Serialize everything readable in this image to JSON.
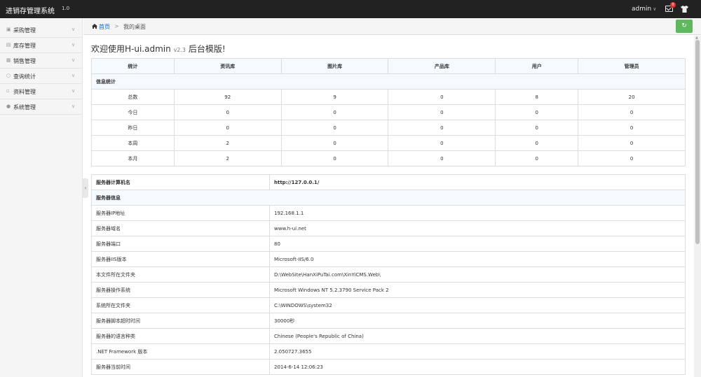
{
  "topbar": {
    "logo": "进销存管理系统",
    "version": "1.0",
    "user": "admin",
    "caret": "∨",
    "message_count": "0"
  },
  "sidebar": {
    "items": [
      {
        "label": "采购管理",
        "icon": "cart-icon"
      },
      {
        "label": "库存管理",
        "icon": "box-icon"
      },
      {
        "label": "销售管理",
        "icon": "tag-icon"
      },
      {
        "label": "查询统计",
        "icon": "search-icon"
      },
      {
        "label": "资料管理",
        "icon": "doc-icon"
      },
      {
        "label": "系统管理",
        "icon": "user-icon"
      }
    ]
  },
  "breadcrumb": {
    "home": "首页",
    "sep": ">",
    "current": "我的桌面"
  },
  "welcome": {
    "prefix": "欢迎使用",
    "product": "H-ui.admin",
    "version": "v2.3",
    "suffix": "后台模版!"
  },
  "stats": {
    "caption": "信息统计",
    "headers": [
      "统计",
      "资讯库",
      "图片库",
      "产品库",
      "用户",
      "管理员"
    ],
    "rows": [
      [
        "总数",
        "92",
        "9",
        "0",
        "8",
        "20"
      ],
      [
        "今日",
        "0",
        "0",
        "0",
        "0",
        "0"
      ],
      [
        "昨日",
        "0",
        "0",
        "0",
        "0",
        "0"
      ],
      [
        "本周",
        "2",
        "0",
        "0",
        "0",
        "0"
      ],
      [
        "本月",
        "2",
        "0",
        "0",
        "0",
        "0"
      ]
    ]
  },
  "server": {
    "caption": "服务器信息",
    "header": [
      "服务器计算机名",
      "http://127.0.0.1/"
    ],
    "rows": [
      [
        "服务器IP地址",
        "192.168.1.1"
      ],
      [
        "服务器域名",
        "www.h-ui.net"
      ],
      [
        "服务器端口",
        "80"
      ],
      [
        "服务器IIS版本",
        "Microsoft-IIS/6.0"
      ],
      [
        "本文件所在文件夹",
        "D:\\WebSite\\HanXiPuTai.com\\XinYiCMS.Web\\"
      ],
      [
        "服务器操作系统",
        "Microsoft Windows NT 5.2.3790 Service Pack 2"
      ],
      [
        "系统所在文件夹",
        "C:\\WINDOWS\\system32"
      ],
      [
        "服务器脚本超时时间",
        "30000秒"
      ],
      [
        "服务器的语言种类",
        "Chinese (People's Republic of China)"
      ],
      [
        ".NET Framework 版本",
        "2.050727.3655"
      ],
      [
        "服务器当前时间",
        "2014-6-14 12:06:23"
      ]
    ]
  },
  "colors": {
    "topbar": "#222222",
    "link": "#0066cc",
    "refresh": "#5eb95e",
    "badge": "#dd3333"
  }
}
